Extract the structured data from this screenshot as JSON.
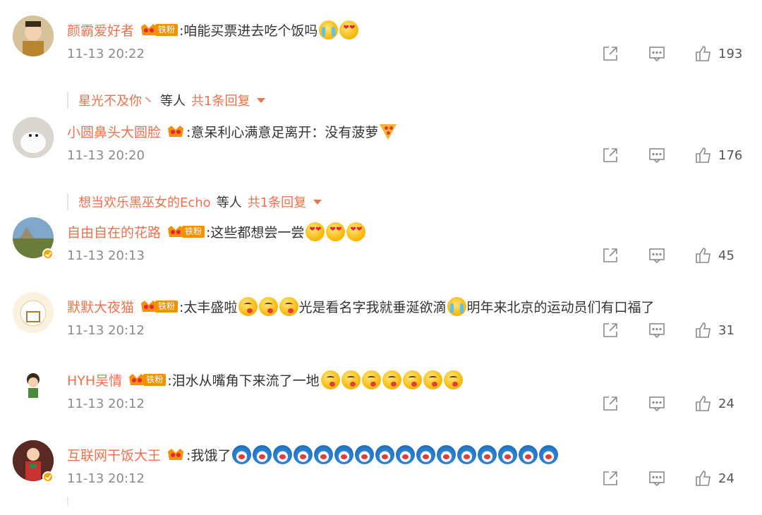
{
  "comments": [
    {
      "user": "颜霸爱好者",
      "fan_level": "铁粉",
      "text": ":咱能买票进去吃个饭吗",
      "time": "11-13 20:22",
      "likes": "193",
      "reply": {
        "from": "星光不及你丶",
        "mid": "等人",
        "total": "共1条回复"
      }
    },
    {
      "user": "小圆鼻头大圆脸",
      "fan_level": "",
      "text": ":意呆利心满意足离开：没有菠萝",
      "time": "11-13 20:20",
      "likes": "176",
      "reply": {
        "from": "想当欢乐黑巫女的Echo",
        "mid": "等人",
        "total": "共1条回复"
      }
    },
    {
      "user": "自由自在的花路",
      "fan_level": "铁粉",
      "text": ":这些都想尝一尝",
      "time": "11-13 20:13",
      "likes": "45"
    },
    {
      "user": "默默大夜猫",
      "fan_level": "铁粉",
      "text": ":太丰盛啦",
      "text2": "光是看名字我就垂涎欲滴",
      "text3": "明年来北京的运动员们有口福了",
      "time": "11-13 20:12",
      "likes": "31"
    },
    {
      "user": "HYH吴情",
      "fan_level": "铁粉",
      "text": ":泪水从嘴角下来流了一地",
      "time": "11-13 20:12",
      "likes": "24"
    },
    {
      "user": "互联网干饭大王",
      "fan_level": "",
      "text": ":我饿了",
      "time": "11-13 20:12",
      "likes": "24"
    }
  ],
  "colors": {
    "accent": "#eb7350",
    "badge": "#f29100",
    "muted": "#8a8a8a"
  },
  "icons": {
    "share": "share-icon",
    "comment": "comment-icon",
    "like": "thumbs-up-icon",
    "crown": "fan-crown-icon"
  }
}
